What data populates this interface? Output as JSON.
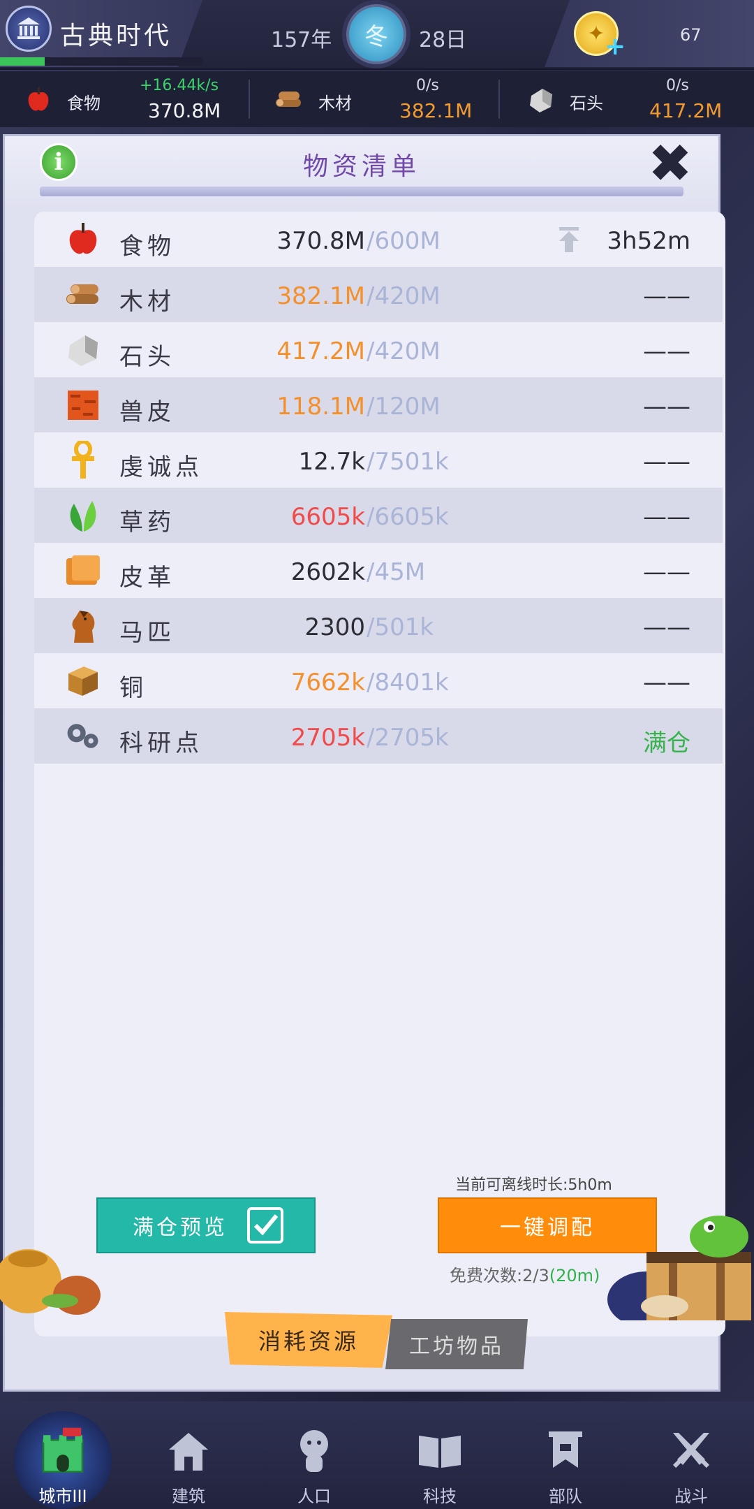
{
  "header": {
    "era_name": "古典时代",
    "era_progress": 0.22,
    "year": "157年",
    "season": "冬",
    "day": "28日",
    "gold": "67",
    "gold_plus": "+"
  },
  "resources": [
    {
      "name": "食物",
      "rate": "+16.44k/s",
      "amount": "370.8M"
    },
    {
      "name": "木材",
      "rate": "0/s",
      "amount": "382.1M"
    },
    {
      "name": "石头",
      "rate": "0/s",
      "amount": "417.2M"
    }
  ],
  "panel": {
    "title": "物资清单",
    "info": "i",
    "close": "✖",
    "rows": [
      {
        "name": "食物",
        "current": "370.8M",
        "capacity": "/600M",
        "status": "3h52m",
        "icon": "apple-icon"
      },
      {
        "name": "木材",
        "current": "382.1M",
        "capacity": "/420M",
        "status": "——",
        "icon": "wood-icon"
      },
      {
        "name": "石头",
        "current": "417.2M",
        "capacity": "/420M",
        "status": "——",
        "icon": "stone-icon"
      },
      {
        "name": "兽皮",
        "current": "118.1M",
        "capacity": "/120M",
        "status": "——",
        "icon": "hide-icon"
      },
      {
        "name": "虔诚点",
        "current": "12.7k",
        "capacity": "/7501k",
        "status": "——",
        "icon": "ankh-icon"
      },
      {
        "name": "草药",
        "current": "6605k",
        "capacity": "/6605k",
        "status": "——",
        "icon": "herb-icon"
      },
      {
        "name": "皮革",
        "current": "2602k",
        "capacity": "/45M",
        "status": "——",
        "icon": "leather-icon"
      },
      {
        "name": "马匹",
        "current": "2300",
        "capacity": "/501k",
        "status": "——",
        "icon": "horse-icon"
      },
      {
        "name": "铜",
        "current": "7662k",
        "capacity": "/8401k",
        "status": "——",
        "icon": "copper-icon"
      },
      {
        "name": "科研点",
        "current": "2705k",
        "capacity": "/2705k",
        "status": "满仓",
        "icon": "gears-icon"
      }
    ],
    "offline_text": "当前可离线时长:5h0m",
    "preview_button": "满仓预览",
    "onekey_button": "一键调配",
    "free_label": "免费次数:2/3",
    "free_extra": "(20m)",
    "tab_consume": "消耗资源",
    "tab_workshop": "工坊物品"
  },
  "nav": [
    {
      "label": "城市III",
      "icon": "castle-icon"
    },
    {
      "label": "建筑",
      "icon": "house-icon"
    },
    {
      "label": "人口",
      "icon": "person-icon"
    },
    {
      "label": "科技",
      "icon": "book-icon"
    },
    {
      "label": "部队",
      "icon": "banner-icon"
    },
    {
      "label": "战斗",
      "icon": "swords-icon"
    }
  ],
  "colors": {
    "accent_orange": "#ff8c0a",
    "accent_teal": "#24b8a8",
    "full_red": "#f04a4a",
    "near_full_orange": "#f4902c",
    "full_green": "#37b24d",
    "title_purple": "#7149a8"
  }
}
